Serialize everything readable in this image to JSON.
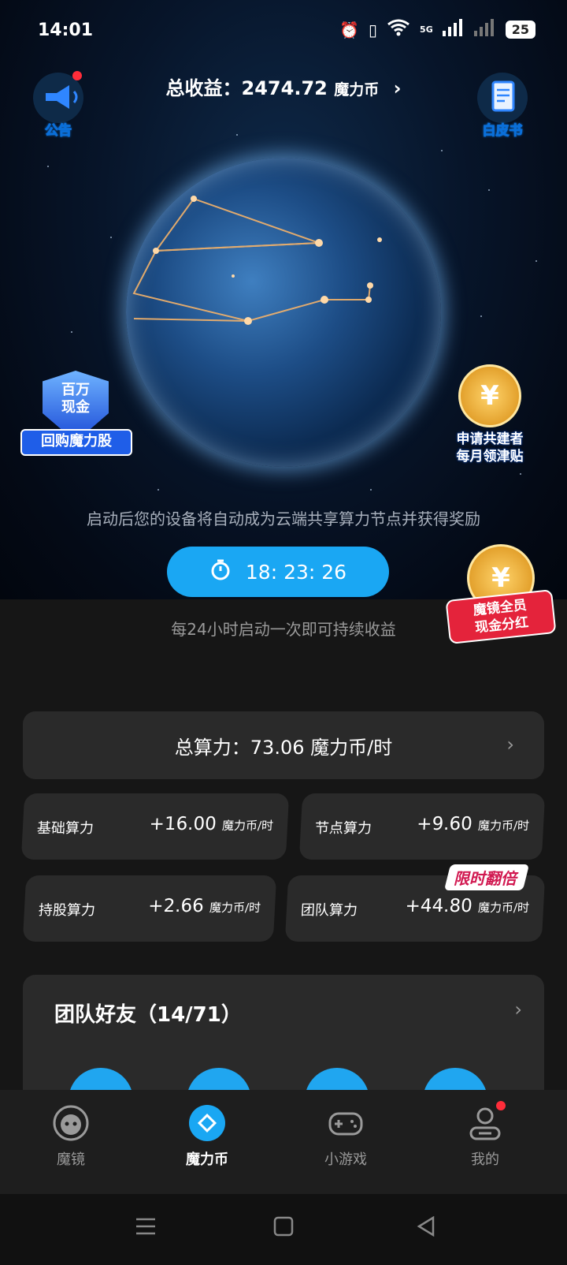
{
  "status": {
    "time": "14:01",
    "network": "5G",
    "battery": "25"
  },
  "header": {
    "earnings_prefix": "总收益：",
    "earnings_value": "2474.72",
    "earnings_unit": "魔力币",
    "arrow": "›"
  },
  "badges": {
    "notice": "公告",
    "whitepaper": "白皮书"
  },
  "promos": {
    "left_top": "百万",
    "left_bottom": "现金",
    "left_ribbon": "回购魔力股",
    "right_coin": "¥",
    "right_line1": "申请共建者",
    "right_line2": "每月领津贴",
    "float_coin": "¥",
    "float_line1": "魔镜全员",
    "float_line2": "现金分红"
  },
  "description": "启动后您的设备将自动成为云端共享算力节点并获得奖励",
  "timer": {
    "value": "18: 23: 26"
  },
  "hint": "每24小时启动一次即可持续收益",
  "total_power": {
    "label": "总算力：73.06 魔力币/时"
  },
  "powers": [
    {
      "name": "基础算力",
      "value": "+16.00",
      "unit": "魔力币/时"
    },
    {
      "name": "节点算力",
      "value": "+9.60",
      "unit": "魔力币/时"
    },
    {
      "name": "持股算力",
      "value": "+2.66",
      "unit": "魔力币/时"
    },
    {
      "name": "团队算力",
      "value": "+44.80",
      "unit": "魔力币/时"
    }
  ],
  "double_tag": "限时翻倍",
  "team": {
    "title": "团队好友（14/71）"
  },
  "tabs": [
    {
      "label": "魔镜",
      "icon": "mirror-face-icon"
    },
    {
      "label": "魔力币",
      "icon": "diamond-coin-icon"
    },
    {
      "label": "小游戏",
      "icon": "gamepad-icon"
    },
    {
      "label": "我的",
      "icon": "profile-icon"
    }
  ],
  "colors": {
    "accent": "#1aa7f3",
    "card": "#2a2a2a",
    "background": "#161616"
  }
}
